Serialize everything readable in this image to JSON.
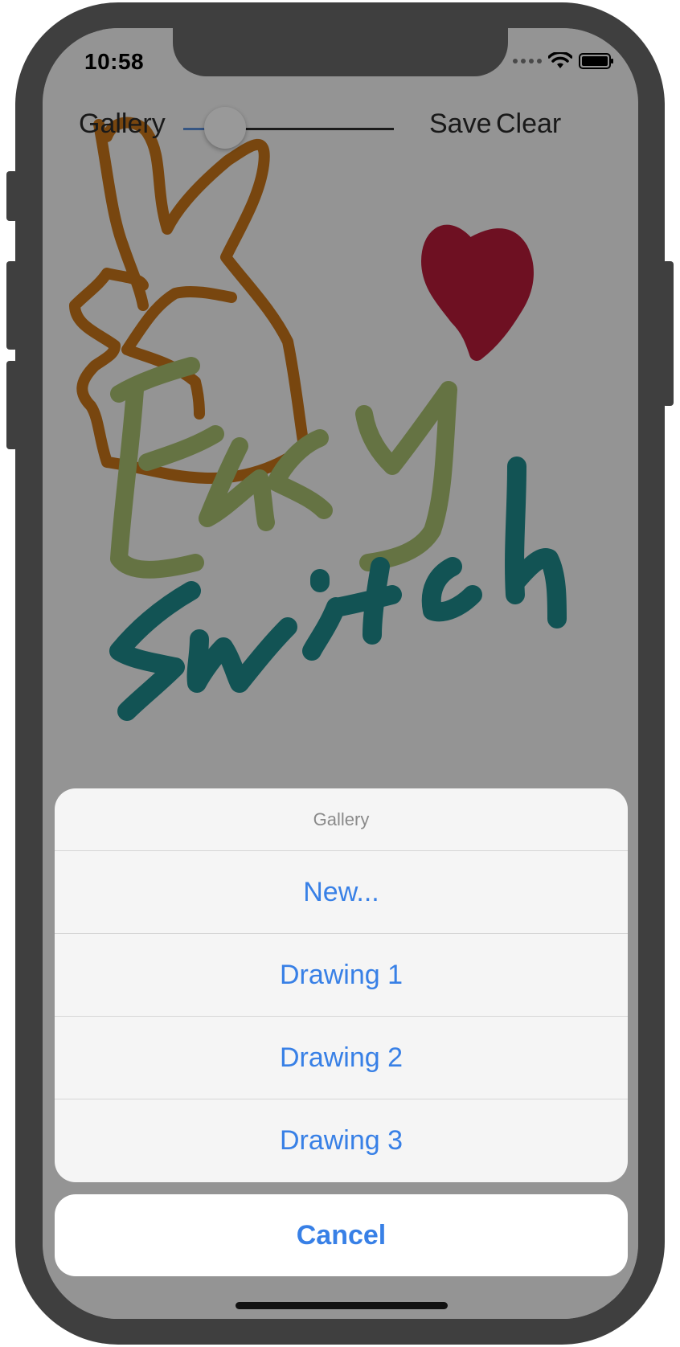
{
  "status_bar": {
    "time": "10:58",
    "wifi_icon": "wifi-icon",
    "battery_icon": "battery-icon"
  },
  "toolbar": {
    "gallery_label": "Gallery",
    "save_label": "Save",
    "clear_label": "Clear",
    "brush_size": 0.2
  },
  "action_sheet": {
    "title": "Gallery",
    "items": [
      "New...",
      "Drawing 1",
      "Drawing 2",
      "Drawing 3"
    ],
    "cancel_label": "Cancel"
  },
  "colors": {
    "accent": "#3880e6",
    "stroke_orange": "#c8761a",
    "stroke_red": "#b71c3a",
    "stroke_olive": "#a8c071",
    "stroke_teal": "#1f8a8c"
  }
}
